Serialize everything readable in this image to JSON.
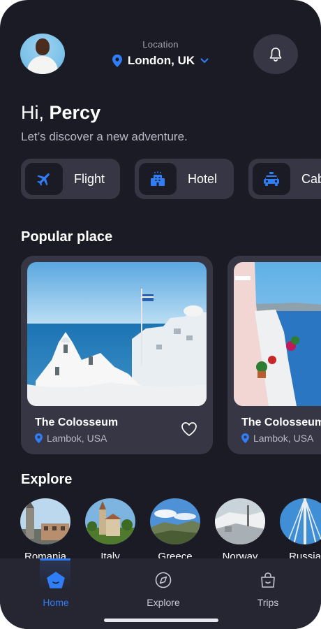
{
  "header": {
    "location_label": "Location",
    "city": "London, UK"
  },
  "greeting": {
    "hi": "Hi,",
    "name": "Percy",
    "subtitle": "Let’s discover a new adventure."
  },
  "categories": [
    {
      "label": "Flight",
      "icon": "plane-icon"
    },
    {
      "label": "Hotel",
      "icon": "hotel-icon"
    },
    {
      "label": "Cab",
      "icon": "taxi-icon"
    }
  ],
  "popular": {
    "title": "Popular place",
    "cards": [
      {
        "name": "The Colosseum",
        "location": "Lambok, USA"
      },
      {
        "name": "The Colosseum",
        "location": "Lambok, USA"
      }
    ]
  },
  "explore": {
    "title": "Explore",
    "countries": [
      "Romania",
      "Italy",
      "Greece",
      "Norway",
      "Russia"
    ]
  },
  "nav": {
    "items": [
      {
        "label": "Home",
        "active": true
      },
      {
        "label": "Explore",
        "active": false
      },
      {
        "label": "Trips",
        "active": false
      }
    ]
  },
  "colors": {
    "background": "#1b1b25",
    "card": "#363645",
    "accent": "#2f7ef8",
    "nav_bg": "#262633"
  }
}
